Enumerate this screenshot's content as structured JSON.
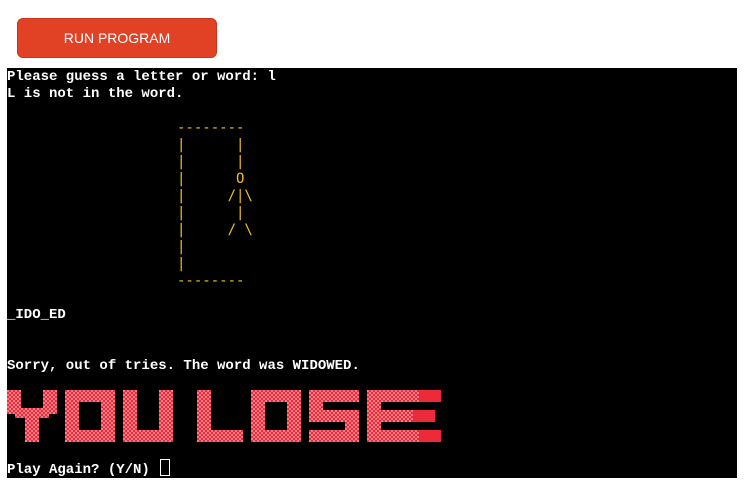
{
  "toolbar": {
    "run_label": "RUN PROGRAM"
  },
  "terminal": {
    "prompt_line": "Please guess a letter or word: l",
    "feedback_line": "L is not in the word.",
    "gallows_art": "--------\n|      |\n|      |\n|      O\n|     /|\\\n|      |\n|     / \\\n|\n|\n--------",
    "word_progress": "_IDO_ED",
    "result_line": "Sorry, out of tries. The word was WIDOWED.",
    "banner_text": "YOU LOSE",
    "play_again_prompt": "Play Again? (Y/N) "
  },
  "colors": {
    "run_button": "#e14225",
    "terminal_bg": "#000000",
    "terminal_text": "#ffffff",
    "gallows": "#f2c026",
    "banner_red": "#ed2a3a",
    "banner_light": "#f08088"
  }
}
